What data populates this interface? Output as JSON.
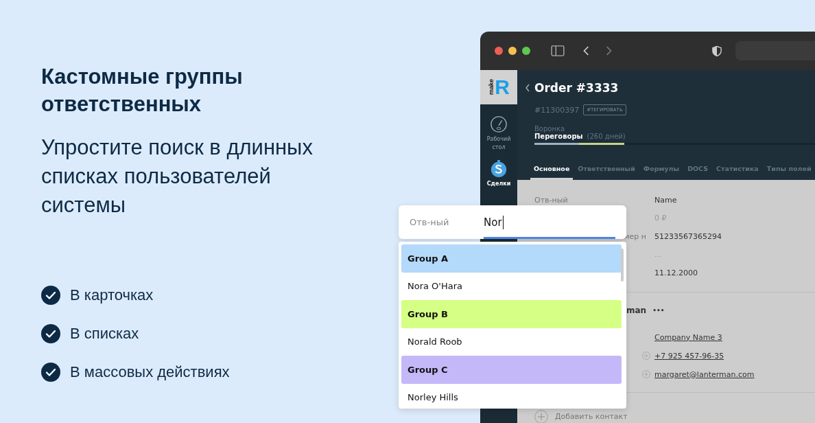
{
  "promo": {
    "title": "Кастомные группы ответственных",
    "subtitle": "Упростите поиск в длинных списках пользователей системы",
    "features": [
      {
        "text": "В карточках"
      },
      {
        "text": "В списках"
      },
      {
        "text": "В массовых действиях"
      }
    ]
  },
  "sidebar": {
    "items": [
      {
        "kind": "dashboard",
        "label": "Рабочий стол"
      },
      {
        "kind": "deals",
        "label": "Сделки"
      }
    ]
  },
  "logo": {
    "word": "make",
    "letter": "R"
  },
  "deal": {
    "title": "Order #3333",
    "id": "#11300397",
    "tag_button": "#ТЕГИРОВАТЬ",
    "pipeline_label": "Воронка",
    "stage": "Переговоры",
    "stage_duration": "(260 дней)",
    "progress": {
      "level": 0.32
    }
  },
  "tabs": [
    {
      "label": "Основное",
      "selected": true
    },
    {
      "label": "Ответственный",
      "selected": false
    },
    {
      "label": "Формулы",
      "selected": false
    },
    {
      "label": "DOCS",
      "selected": false
    },
    {
      "label": "Статистика",
      "selected": false
    },
    {
      "label": "Типы полей",
      "selected": false
    }
  ],
  "fields": {
    "header_label": "Отв-ный",
    "header_value": "Name",
    "rows": [
      {
        "value": "0 ₽",
        "muted": true
      },
      {
        "label": "мер н",
        "value": "51233567365294",
        "muted": false
      },
      {
        "value": "...",
        "muted": true
      },
      {
        "value": "11.12.2000",
        "muted": false
      }
    ]
  },
  "contact": {
    "name": "man",
    "more": "•••",
    "rows": [
      {
        "value": "Company Name 3",
        "plus": false
      },
      {
        "value": "+7 925 457-96-35",
        "plus": true
      },
      {
        "value": "margaret@lanterman.com",
        "plus": true
      }
    ],
    "add_button": "Добавить контакт"
  },
  "dropdown": {
    "label": "Отв-ный",
    "value": "Nor",
    "options": [
      {
        "kind": "group",
        "text": "Group A",
        "color": "#b3d9fb"
      },
      {
        "kind": "user",
        "text": "Nora O'Hara"
      },
      {
        "kind": "group",
        "text": "Group B",
        "color": "#d6ff85"
      },
      {
        "kind": "user",
        "text": "Norald Roob"
      },
      {
        "kind": "group",
        "text": "Group C",
        "color": "#c5b8f9"
      },
      {
        "kind": "user",
        "text": "Norley Hills"
      }
    ]
  }
}
